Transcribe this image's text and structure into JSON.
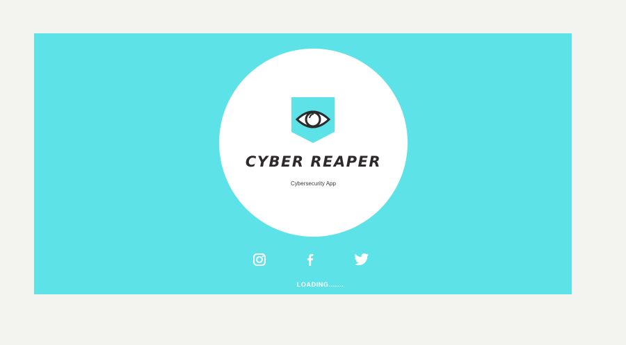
{
  "splash": {
    "background_color": "#5de2e7",
    "logo": {
      "icon": "eye-shield-icon",
      "title": "CYBER REAPER",
      "subtitle": "Cybersecurity App"
    },
    "social_links": [
      {
        "name": "Instagram",
        "icon": "instagram-icon"
      },
      {
        "name": "Facebook",
        "icon": "facebook-icon"
      },
      {
        "name": "Twitter",
        "icon": "twitter-icon"
      }
    ],
    "status_text": "LOADING......."
  }
}
